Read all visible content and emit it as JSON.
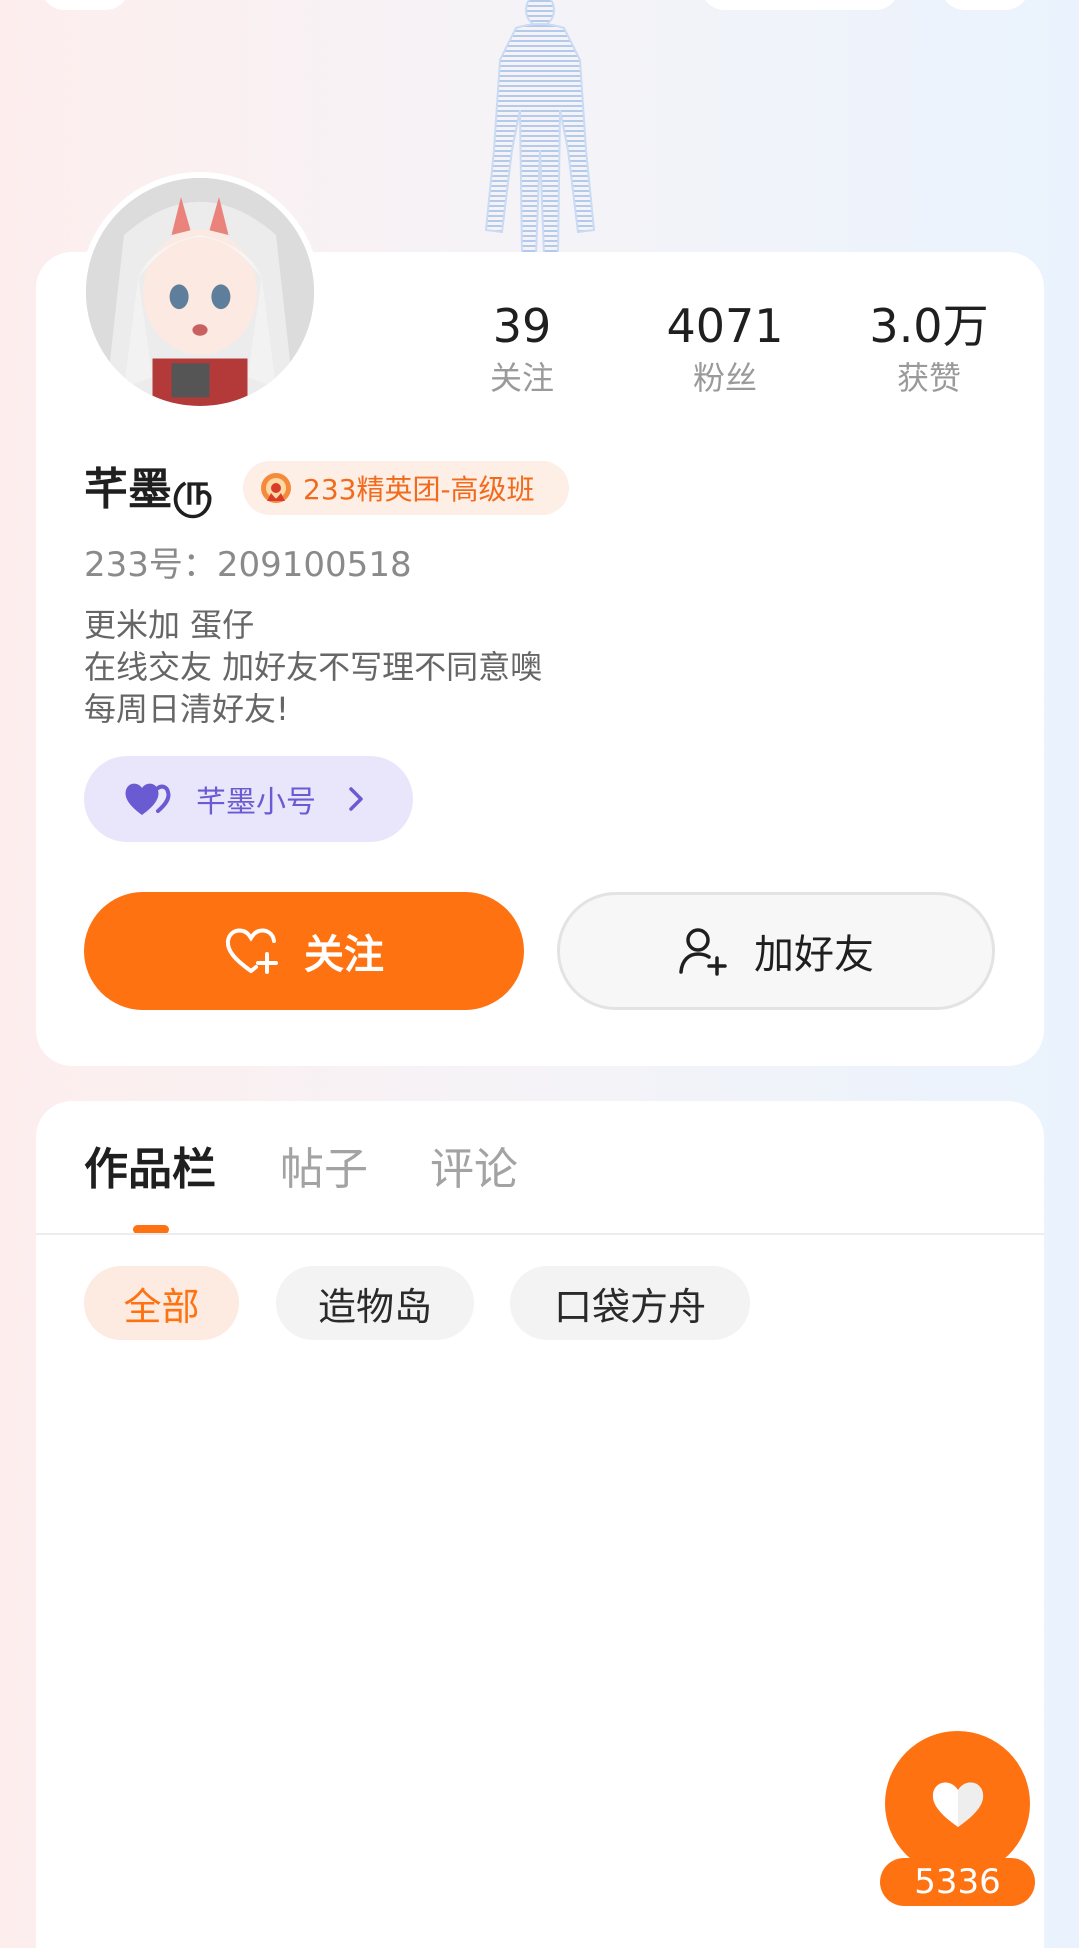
{
  "profile": {
    "stats": [
      {
        "value": "39",
        "label": "关注"
      },
      {
        "value": "4071",
        "label": "粉丝"
      },
      {
        "value": "3.0万",
        "label": "获赞"
      }
    ],
    "username": "芊墨ரு",
    "badge": "233精英团-高级班",
    "account_id": "233号：209100518",
    "bio": [
      "更米加 蛋仔",
      "在线交友 加好友不写理不同意噢",
      "每周日清好友!"
    ],
    "alt_account_label": "芊墨小号",
    "follow_label": "关注",
    "add_friend_label": "加好友"
  },
  "tabs": [
    "作品栏",
    "帖子",
    "评论"
  ],
  "active_tab": 0,
  "filters": [
    "全部",
    "造物岛",
    "口袋方舟"
  ],
  "active_filter": 0,
  "like_count": "5336",
  "colors": {
    "accent": "#ff7212",
    "alt_account_bg": "#e9e6fb",
    "alt_account_text": "#6b5bd2",
    "badge_bg": "#fdeee6"
  },
  "icons": {
    "follow": "heart-plus-icon",
    "add_friend": "user-plus-icon",
    "alt_account": "double-heart-icon",
    "like": "heart-icon"
  }
}
